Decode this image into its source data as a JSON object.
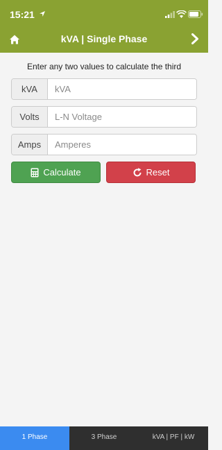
{
  "status_bar": {
    "time": "15:21"
  },
  "header": {
    "title": "kVA | Single Phase"
  },
  "instruction": "Enter any two values to calculate the third",
  "fields": [
    {
      "label": "kVA",
      "placeholder": "kVA",
      "value": ""
    },
    {
      "label": "Volts",
      "placeholder": "L-N Voltage",
      "value": ""
    },
    {
      "label": "Amps",
      "placeholder": "Amperes",
      "value": ""
    }
  ],
  "buttons": {
    "calculate": "Calculate",
    "reset": "Reset"
  },
  "tabs": [
    {
      "label": "1 Phase",
      "active": true
    },
    {
      "label": "3 Phase",
      "active": false
    },
    {
      "label": "kVA | PF | kW",
      "active": false
    }
  ],
  "colors": {
    "header": "#8aa232",
    "calculate": "#4fa252",
    "reset": "#d2414a",
    "active_tab": "#3b8bf0",
    "tabbar": "#2f2f2f"
  }
}
